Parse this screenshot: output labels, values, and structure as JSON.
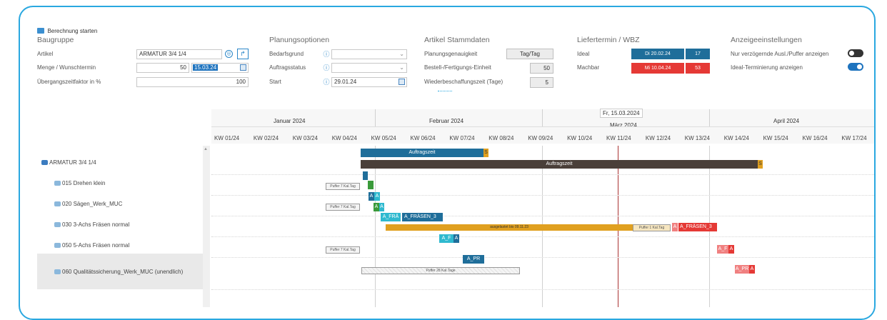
{
  "toolbar": {
    "calc_label": "Berechnung starten"
  },
  "baugruppe": {
    "title": "Baugruppe",
    "artikel_label": "Artikel",
    "artikel_value": "ARMATUR 3/4 1/4",
    "menge_label": "Menge / Wunschtermin",
    "menge_value": "50",
    "wunschtermin_value": "15.03.24",
    "uebergang_label": "Übergangszeitfaktor in %",
    "uebergang_value": "100"
  },
  "planung": {
    "title": "Planungsoptionen",
    "bedarfsgrund_label": "Bedarfsgrund",
    "auftragsstatus_label": "Auftragsstatus",
    "start_label": "Start",
    "start_value": "29.01.24"
  },
  "artikel": {
    "title": "Artikel Stammdaten",
    "genauigkeit_label": "Planungsgenauigkeit",
    "genauigkeit_value": "Tag/Tag",
    "einheit_label": "Bestell-/Fertigungs-Einheit",
    "einheit_value": "50",
    "wbz_label": "Wiederbeschaffungszeit (Tage)",
    "wbz_value": "5"
  },
  "liefertermin": {
    "title": "Liefertermin / WBZ",
    "ideal_label": "Ideal",
    "ideal_date": "Di 20.02.24",
    "ideal_days": "17",
    "machbar_label": "Machbar",
    "machbar_date": "Mi 10.04.24",
    "machbar_days": "53"
  },
  "anzeige": {
    "title": "Anzeigeeinstellungen",
    "opt1_label": "Nur verzögernde Ausl./Puffer anzeigen",
    "opt1_on": false,
    "opt2_label": "Ideal-Terminierung anzeigen",
    "opt2_on": true
  },
  "gantt": {
    "months": [
      "Januar 2024",
      "Februar 2024",
      "März 2024",
      "April 2024"
    ],
    "tooltip_date": "Fr, 15.03.2024",
    "weeks": [
      "KW 01/24",
      "KW 02/24",
      "KW 03/24",
      "KW 04/24",
      "KW 05/24",
      "KW 06/24",
      "KW 07/24",
      "KW 08/24",
      "KW 09/24",
      "KW 10/24",
      "KW 11/24",
      "KW 12/24",
      "KW 13/24",
      "KW 14/24",
      "KW 15/24",
      "KW 16/24",
      "KW 17/24",
      "1"
    ],
    "rows": [
      {
        "label": "ARMATUR 3/4 1/4"
      },
      {
        "label": "015 Drehen klein"
      },
      {
        "label": "020 Sägen_Werk_MUC"
      },
      {
        "label": "030 3-Achs Fräsen normal"
      },
      {
        "label": "050 5-Achs Fräsen normal"
      },
      {
        "label": "060 Qualitätssicherung_Werk_MUC (unendlich)"
      }
    ],
    "bars": {
      "auftragszeit_label": "Auftragszeit",
      "auftragszeit2_label": "Auftragszeit",
      "s_label": "S",
      "puffer1": "Puffer 7 Kal.Tag",
      "puffer2": "Puffer 7 Kal.Tag",
      "a_label": "A",
      "a_fra_label": "A_FRÄ",
      "a_fraesen_label": "A_FRÄSEN_3",
      "ausgelastet": "ausgelastet bis 09.11.23",
      "puffer_tag": "Puffer 1 Kal.Tag",
      "a_fraesen_red": "A_FRÄSEN_3",
      "a_f_label": "A_F",
      "puffer3": "Puffer 7 Kal.Tag",
      "a_pr_label": "A_PR",
      "puffer4": "Puffer 28 Kal.Tage"
    }
  },
  "colors": {
    "frame": "#2aa8e0",
    "blue": "#1f6e9a",
    "red": "#e53935",
    "orange": "#e0a020",
    "dark": "#4a3f39",
    "green": "#3a9a3a",
    "cyan": "#2fb9cf"
  }
}
